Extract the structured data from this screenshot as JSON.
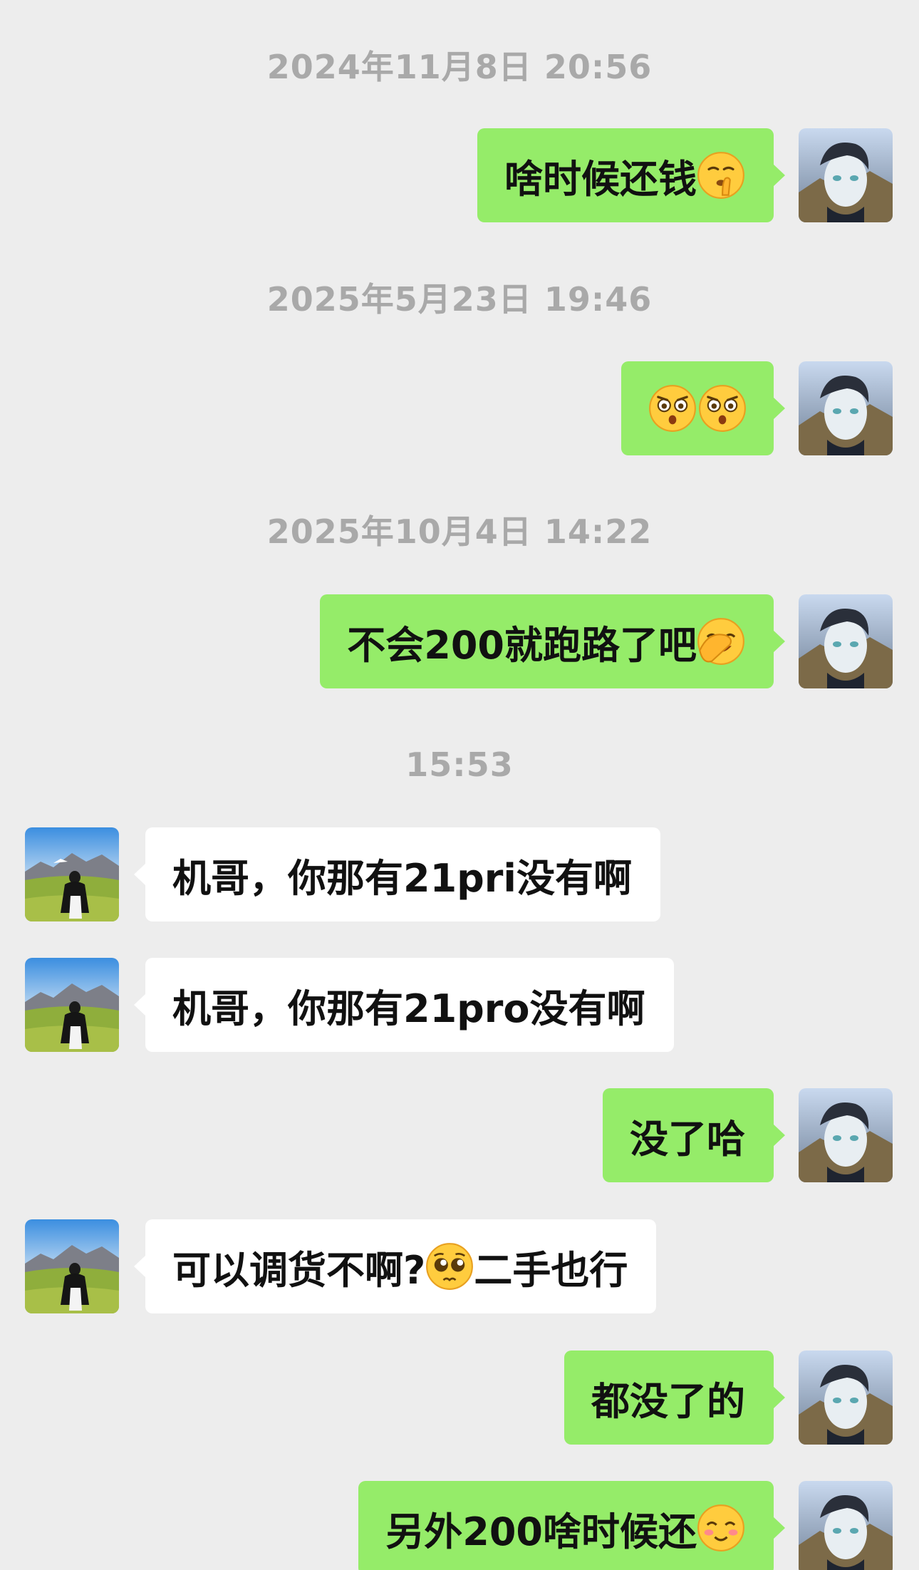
{
  "timestamps": {
    "t1": "2024年11月8日 20:56",
    "t2": "2025年5月23日 19:46",
    "t3": "2025年10月4日 14:22",
    "t4": "15:53"
  },
  "messages": [
    {
      "sender": "me",
      "text": "啥时候还钱",
      "emoji": "shushing-face-emoji"
    },
    {
      "sender": "me",
      "text": "",
      "emoji": "astonished-face-emoji x2"
    },
    {
      "sender": "me",
      "text": "不会200就跑路了吧",
      "emoji": "face-palm-laughing-emoji"
    },
    {
      "sender": "them",
      "text": "机哥，你那有21pri没有啊"
    },
    {
      "sender": "them",
      "text": "机哥，你那有21pro没有啊"
    },
    {
      "sender": "me",
      "text": "没了哈"
    },
    {
      "sender": "them",
      "text_before": "可以调货不啊?",
      "emoji": "pleading-face-emoji",
      "text_after": "二手也行"
    },
    {
      "sender": "me",
      "text": "都没了的"
    },
    {
      "sender": "me",
      "text": "另外200啥时候还",
      "emoji": "blushing-smile-emoji"
    }
  ],
  "colors": {
    "background": "#ededed",
    "my_bubble": "#95ec69",
    "their_bubble": "#ffffff",
    "timestamp": "#a9a9a9"
  }
}
